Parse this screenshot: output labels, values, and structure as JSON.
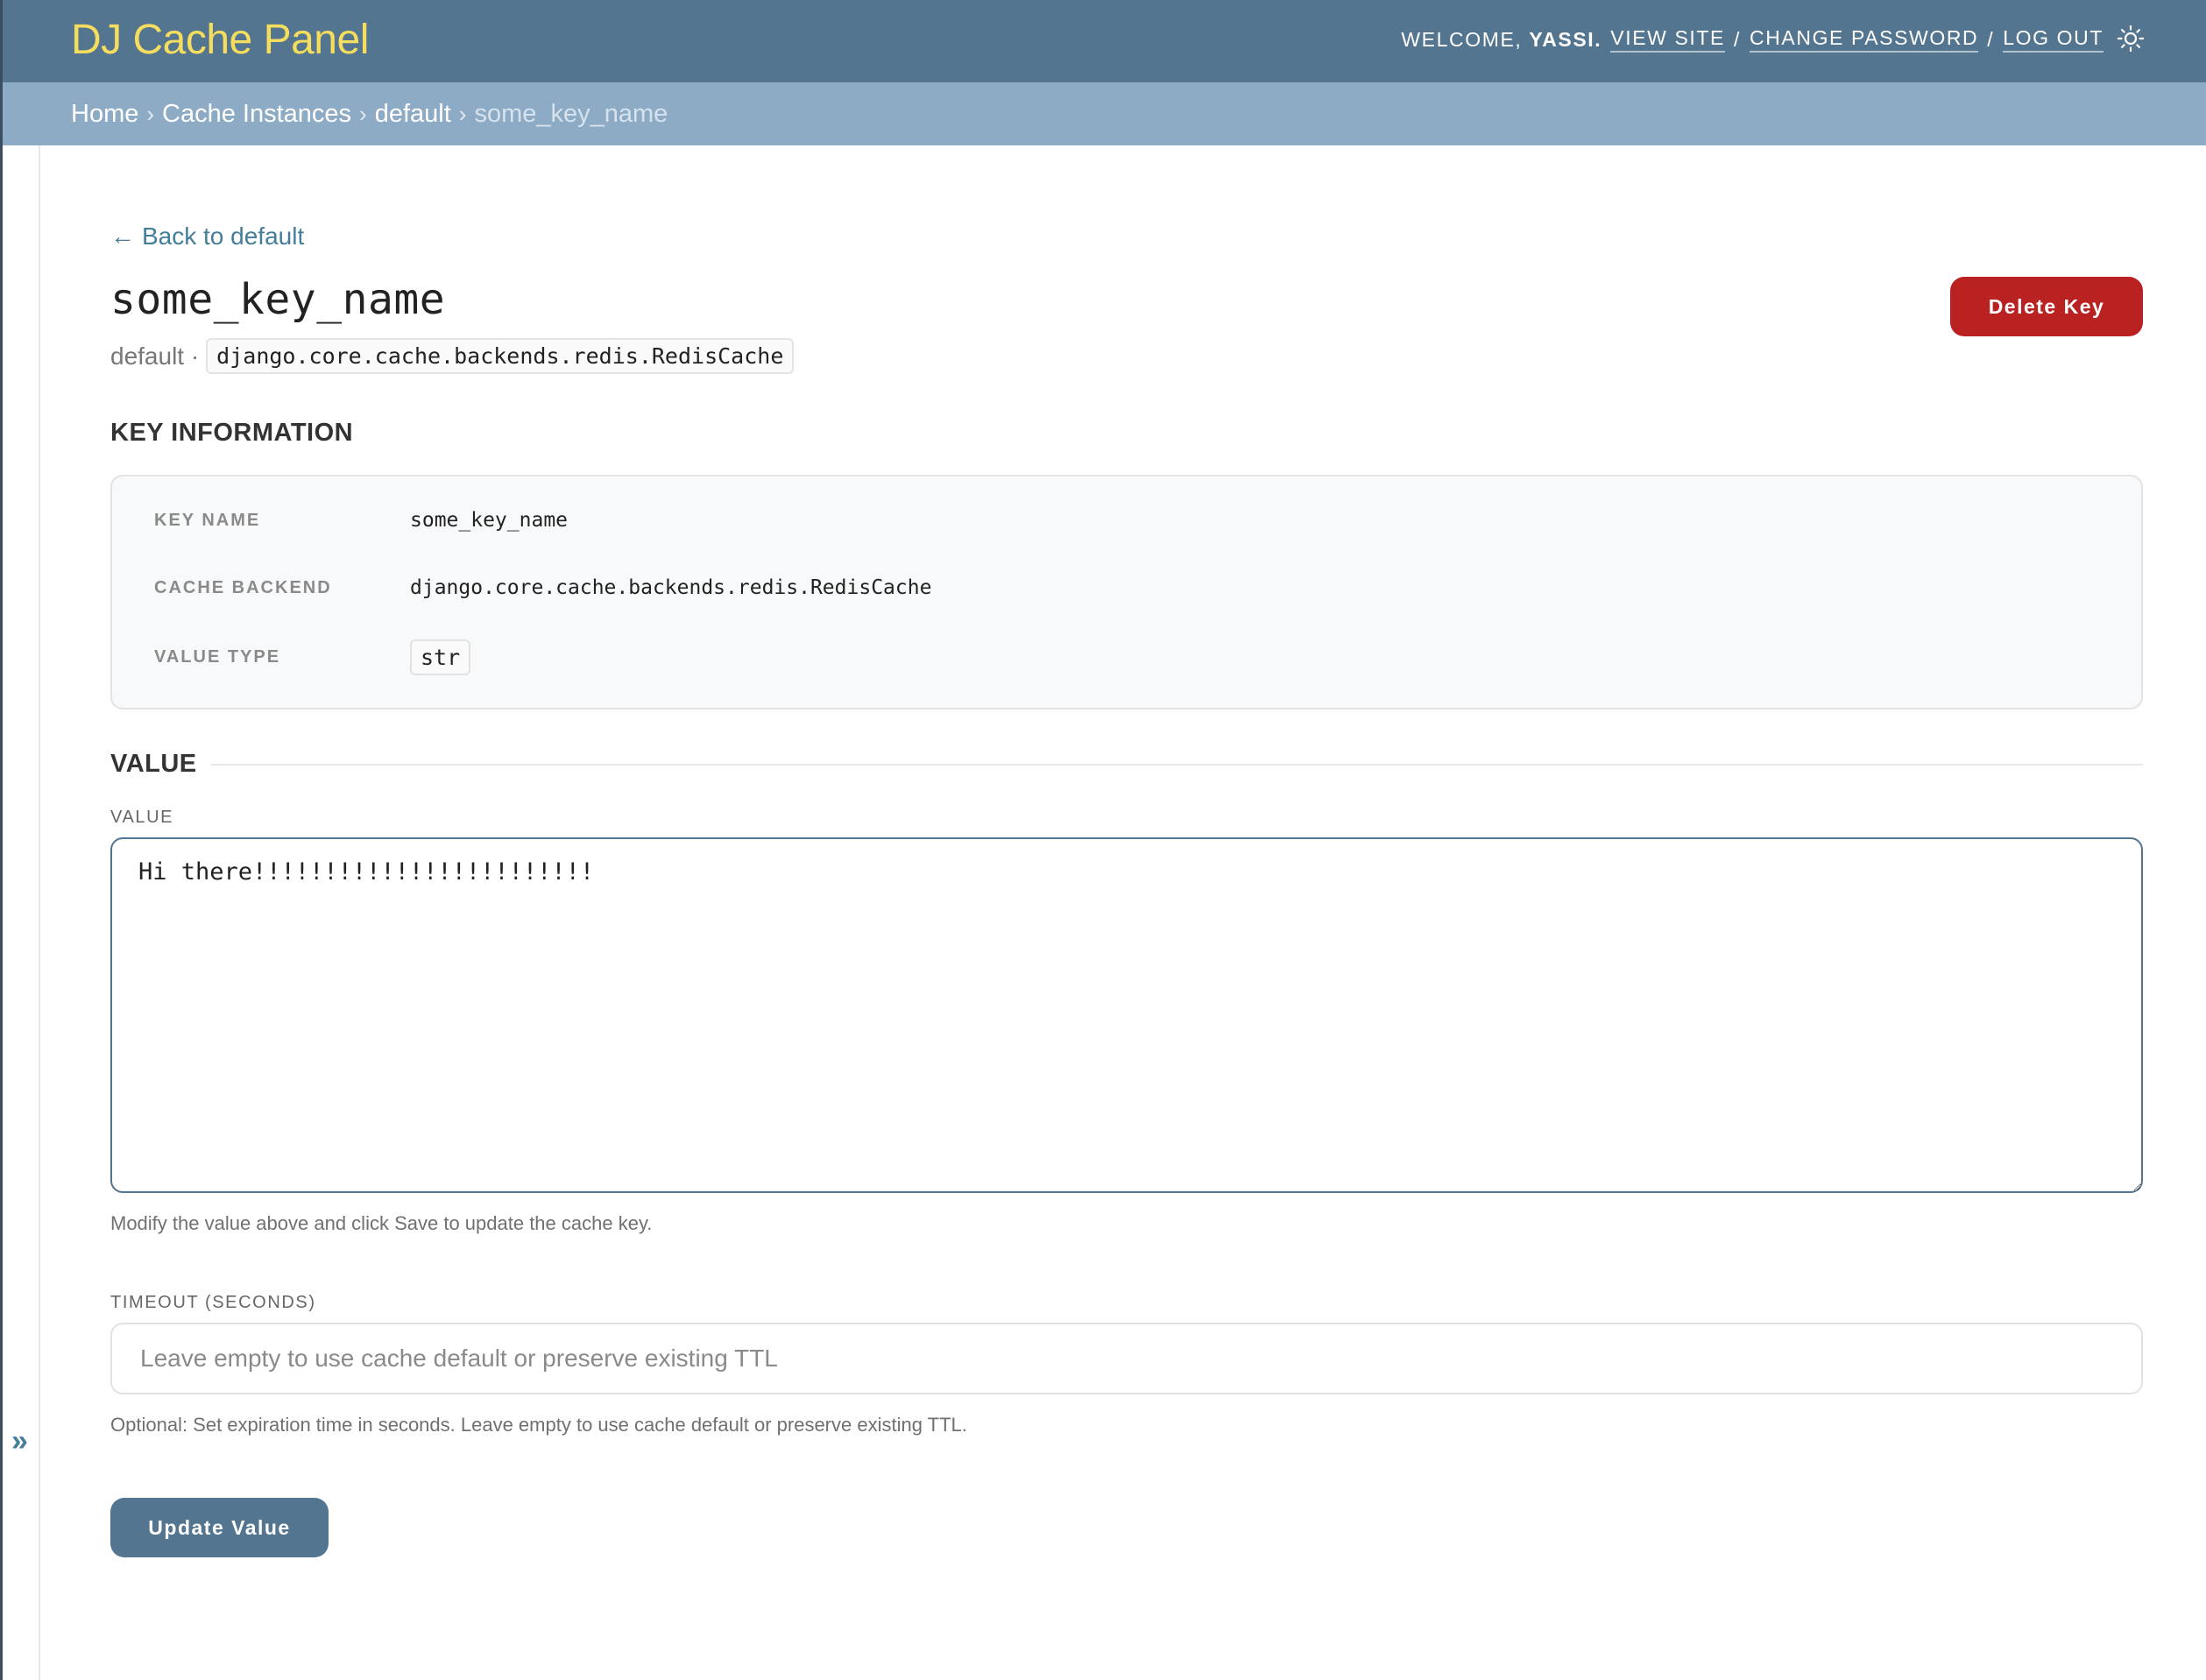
{
  "header": {
    "branding": "DJ Cache Panel",
    "welcome_prefix": "WELCOME,",
    "username": "YASSI.",
    "view_site": "VIEW SITE",
    "change_password": "CHANGE PASSWORD",
    "log_out": "LOG OUT",
    "separator": "/",
    "theme_icon": "sun-icon"
  },
  "breadcrumbs": {
    "items": [
      "Home",
      "Cache Instances",
      "default"
    ],
    "current": "some_key_name",
    "separator": "›"
  },
  "nav": {
    "toggle_label": "»"
  },
  "page": {
    "back_arrow": "←",
    "back_link": "Back to default",
    "title": "some_key_name",
    "subtitle_cache": "default ·",
    "subtitle_backend": "django.core.cache.backends.redis.RedisCache",
    "delete_button": "Delete Key"
  },
  "key_info": {
    "heading": "KEY INFORMATION",
    "rows": [
      {
        "label": "KEY NAME",
        "value": "some_key_name"
      },
      {
        "label": "CACHE BACKEND",
        "value": "django.core.cache.backends.redis.RedisCache"
      },
      {
        "label": "VALUE TYPE",
        "value": "str"
      }
    ]
  },
  "value_section": {
    "heading": "VALUE",
    "field_label": "VALUE",
    "value": "Hi there!!!!!!!!!!!!!!!!!!!!!!!!",
    "help": "Modify the value above and click Save to update the cache key."
  },
  "timeout": {
    "label": "TIMEOUT (SECONDS)",
    "value": "",
    "placeholder": "Leave empty to use cache default or preserve existing TTL",
    "help": "Optional: Set expiration time in seconds. Leave empty to use cache default or preserve existing TTL."
  },
  "actions": {
    "update_button": "Update Value"
  },
  "colors": {
    "header_bg": "#54758f",
    "breadcrumb_bg": "#8dabc5",
    "branding": "#f5dd5d",
    "link": "#447e9b",
    "danger": "#ba2121",
    "primary_button": "#54758f"
  }
}
